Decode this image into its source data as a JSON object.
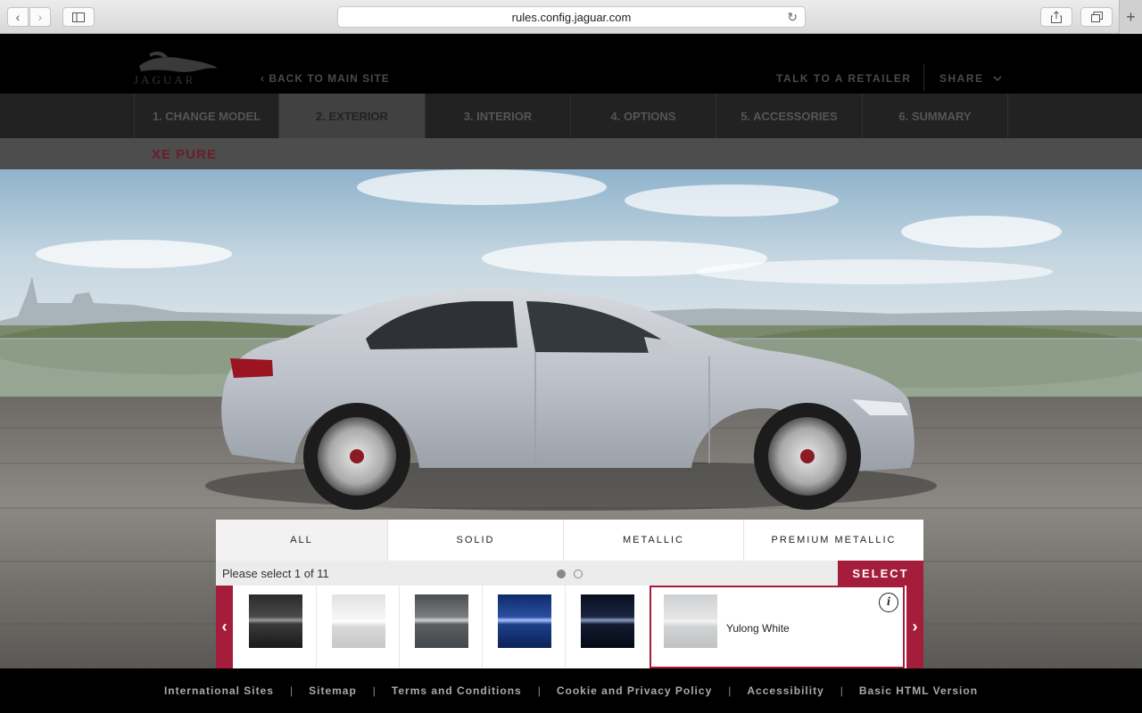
{
  "browser": {
    "url": "rules.config.jaguar.com"
  },
  "header": {
    "logo_text": "JAGUAR",
    "back_link": "BACK TO MAIN SITE",
    "talk_link": "TALK TO A RETAILER",
    "share_link": "SHARE"
  },
  "steps": [
    {
      "label": "1. CHANGE MODEL"
    },
    {
      "label": "2. EXTERIOR"
    },
    {
      "label": "3. INTERIOR"
    },
    {
      "label": "4. OPTIONS"
    },
    {
      "label": "5. ACCESSORIES"
    },
    {
      "label": "6. SUMMARY"
    }
  ],
  "model": {
    "name": "XE PURE"
  },
  "color_panel": {
    "filters": [
      {
        "label": "ALL"
      },
      {
        "label": "SOLID"
      },
      {
        "label": "METALLIC"
      },
      {
        "label": "PREMIUM METALLIC"
      }
    ],
    "prompt": "Please select 1 of 11",
    "select_label": "SELECT",
    "selected_name": "Yulong White",
    "page_count": 2,
    "current_page": 1
  },
  "footer": {
    "links": [
      {
        "label": "International Sites"
      },
      {
        "label": "Sitemap"
      },
      {
        "label": "Terms and Conditions"
      },
      {
        "label": "Cookie and Privacy Policy"
      },
      {
        "label": "Accessibility"
      },
      {
        "label": "Basic HTML Version"
      }
    ]
  },
  "colors": {
    "accent": "#a41d3a",
    "model_name": "#6a1d2b"
  }
}
